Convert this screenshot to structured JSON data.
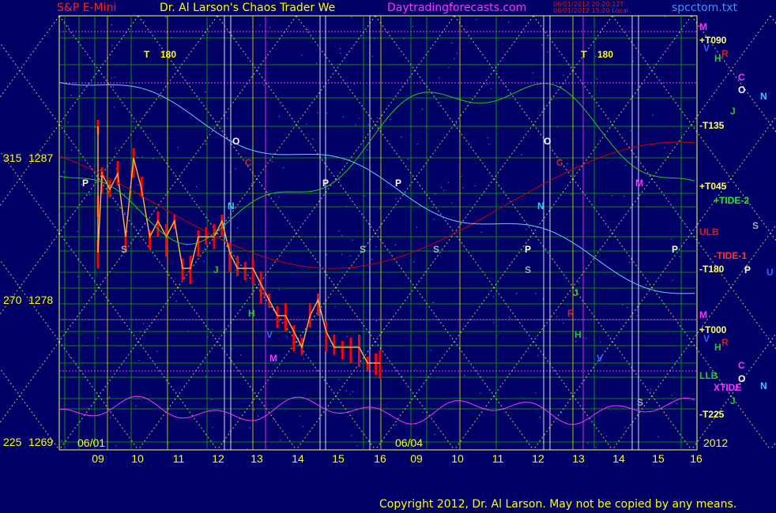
{
  "header": {
    "instrument": "S&P E-Mini",
    "title": "Dr. Al Larson's Chaos Trader We",
    "site": "Daytradingforecasts.com",
    "timestamp_1": "06/01/2012 20:20:12T",
    "timestamp_2": "06/01/2012 15:20 Local",
    "file": "spcctom.txt"
  },
  "footer": {
    "copyright": "Copyright 2012, Dr. Al Larson. May not be copied by any means."
  },
  "colors": {
    "background": "#000066",
    "price": "#ff0000",
    "grid_green": "#00aa00",
    "forecast_yellow": "#ffff66",
    "axis_yellow": "#ffff00",
    "white": "#ffffff",
    "magenta": "#ff33ff",
    "cyan": "#66ccff",
    "green_line": "#22cc22",
    "red_line": "#cc0000"
  },
  "chart_data": {
    "type": "line",
    "y_axis": {
      "ylim": [
        1269,
        1290
      ],
      "ticks": [
        {
          "deg": "315",
          "price": "1287",
          "value": 1287
        },
        {
          "deg": "270",
          "price": "1278",
          "value": 1278
        },
        {
          "deg": "225",
          "price": "1269",
          "value": 1269
        }
      ]
    },
    "x_axis": {
      "ticks": [
        "09",
        "10",
        "11",
        "12",
        "13",
        "14",
        "15",
        "16",
        "09",
        "10",
        "11",
        "12",
        "13",
        "14",
        "15",
        "16"
      ],
      "date_labels": [
        "06/01",
        "06/04"
      ],
      "year": "2012"
    },
    "series": [
      {
        "name": "price",
        "color": "#ff0000",
        "x": [
          8.5,
          8.7,
          8.9,
          9.1,
          9.3,
          9.5,
          9.7,
          9.9,
          10.1,
          10.3,
          10.5,
          10.7,
          10.9,
          11.1,
          11.3,
          11.5,
          11.7,
          11.9,
          12.1,
          12.3,
          12.5,
          12.7,
          12.9,
          13.1,
          13.3,
          13.5,
          13.7,
          13.9,
          14.1,
          14.3,
          14.5,
          14.7,
          14.9,
          15.1,
          15.3,
          15.5,
          15.7,
          15.9,
          16.0
        ],
        "values": [
          1289,
          1284,
          1281,
          1286,
          1285,
          1286,
          1282,
          1287,
          1285,
          1282,
          1283,
          1282,
          1283,
          1280,
          1280,
          1282,
          1282,
          1282,
          1283,
          1281,
          1280,
          1280,
          1280,
          1279,
          1278,
          1277,
          1277,
          1276,
          1275,
          1277,
          1278,
          1276,
          1275,
          1275,
          1275,
          1275,
          1274,
          1274,
          1274
        ]
      }
    ],
    "right_labels": [
      "M",
      "+T090",
      "V",
      "H",
      "R",
      "C",
      "O",
      "N",
      "J",
      "-T135",
      "+T045",
      "+TIDE-2",
      "S",
      "ULB",
      "-TIDE-1",
      "-T180",
      "P",
      "U",
      "M",
      "+T000",
      "V",
      "H",
      "R",
      "LLB",
      "C",
      "O",
      "XTIDE",
      "N",
      "J",
      "-T225"
    ],
    "chart_markers": [
      "T",
      "180",
      "T",
      "180",
      "P",
      "O",
      "C",
      "N",
      "S",
      "J",
      "R",
      "H",
      "V",
      "M",
      "P",
      "S",
      "P",
      "S",
      "P",
      "O",
      "C",
      "N",
      "S",
      "J",
      "R",
      "H",
      "V",
      "M",
      "P",
      "S"
    ]
  }
}
